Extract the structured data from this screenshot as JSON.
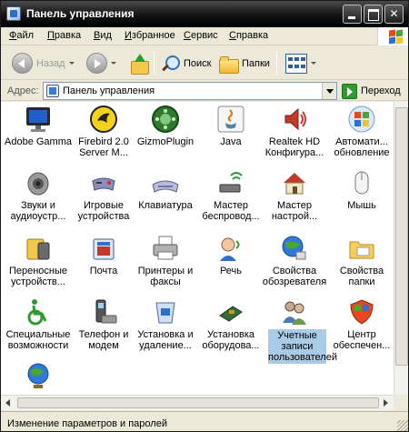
{
  "window": {
    "title": "Панель управления"
  },
  "menu": [
    {
      "label": "Файл",
      "ul": "Ф",
      "rest": "айл"
    },
    {
      "label": "Правка",
      "ul": "П",
      "rest": "равка"
    },
    {
      "label": "Вид",
      "ul": "В",
      "rest": "ид"
    },
    {
      "label": "Избранное",
      "ul": "И",
      "rest": "збранное"
    },
    {
      "label": "Сервис",
      "ul": "С",
      "rest": "ервис"
    },
    {
      "label": "Справка",
      "ul": "С",
      "rest": "правка"
    }
  ],
  "toolbar": {
    "back_label": "Назад",
    "search_label": "Поиск",
    "folders_label": "Папки"
  },
  "address": {
    "label": "Адрес:",
    "value": "Панель управления",
    "go_label": "Переход"
  },
  "items": [
    {
      "label": "Adobe Gamma",
      "icon": "adobe-gamma-icon"
    },
    {
      "label": "Firebird 2.0 Server M...",
      "icon": "firebird-icon"
    },
    {
      "label": "GizmoPlugin",
      "icon": "gizmo-plugin-icon"
    },
    {
      "label": "Java",
      "icon": "java-icon"
    },
    {
      "label": "Realtek HD Конфигура...",
      "icon": "realtek-audio-icon"
    },
    {
      "label": "Автомати... обновление",
      "icon": "automatic-updates-icon"
    },
    {
      "label": "Звуки и аудиоустр...",
      "icon": "sounds-audio-icon"
    },
    {
      "label": "Игровые устройства",
      "icon": "game-controllers-icon"
    },
    {
      "label": "Клавиатура",
      "icon": "keyboard-icon"
    },
    {
      "label": "Мастер беспровод...",
      "icon": "wireless-wizard-icon"
    },
    {
      "label": "Мастер настрой...",
      "icon": "network-wizard-icon"
    },
    {
      "label": "Мышь",
      "icon": "mouse-icon"
    },
    {
      "label": "Переносные устройств...",
      "icon": "portable-devices-icon"
    },
    {
      "label": "Почта",
      "icon": "mail-icon"
    },
    {
      "label": "Принтеры и факсы",
      "icon": "printers-faxes-icon"
    },
    {
      "label": "Речь",
      "icon": "speech-icon"
    },
    {
      "label": "Свойства обозревателя",
      "icon": "internet-options-icon"
    },
    {
      "label": "Свойства папки",
      "icon": "folder-options-icon"
    },
    {
      "label": "Специальные возможности",
      "icon": "accessibility-icon"
    },
    {
      "label": "Телефон и модем",
      "icon": "phone-modem-icon"
    },
    {
      "label": "Установка и удаление...",
      "icon": "add-remove-programs-icon"
    },
    {
      "label": "Установка оборудова...",
      "icon": "add-hardware-icon"
    },
    {
      "label": "Учетные записи пользователей",
      "icon": "user-accounts-icon",
      "selected": true
    },
    {
      "label": "Центр обеспечен...",
      "icon": "security-center-icon"
    },
    {
      "label": "",
      "icon": "regional-options-icon"
    }
  ],
  "status": {
    "text": "Изменение параметров и паролей"
  }
}
